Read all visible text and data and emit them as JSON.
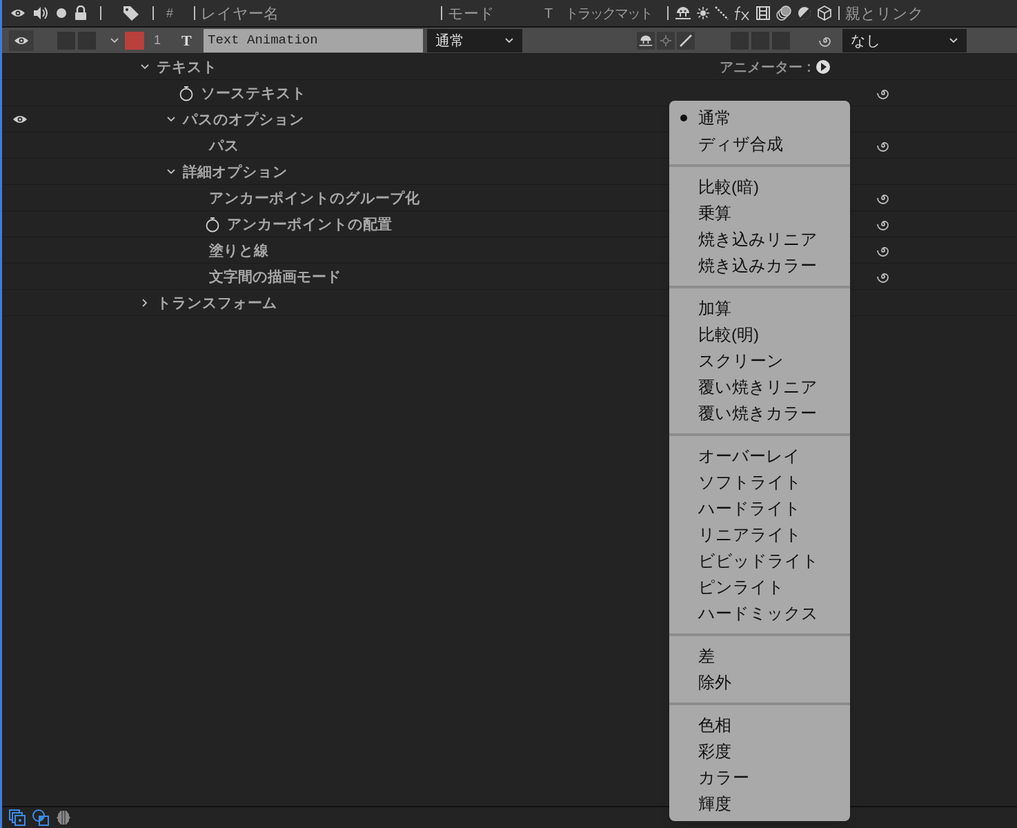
{
  "header": {
    "number": "#",
    "layer_name": "レイヤー名",
    "mode": "モード",
    "track_t": "T",
    "track_matte": "トラックマット",
    "parent": "親とリンク"
  },
  "layer": {
    "visible": true,
    "expanded": true,
    "switches": {
      "shy": true,
      "collapse": false,
      "quality": true
    },
    "number": "1",
    "type_glyph": "T",
    "name": "Text Animation",
    "mode": "通常",
    "parent": "なし"
  },
  "properties": [
    {
      "label": "テキスト",
      "expanded": true,
      "animator": "アニメーター",
      "animator_sep": ":",
      "children": [
        {
          "label": "ソーステキスト",
          "stopwatch": true,
          "pickwhip": true
        },
        {
          "label": "パスのオプション",
          "expanded": true,
          "visible": true,
          "children": [
            {
              "label": "パス",
              "pickwhip": true
            }
          ]
        },
        {
          "label": "詳細オプション",
          "expanded": true,
          "children": [
            {
              "label": "アンカーポイントのグループ化",
              "pickwhip": true
            },
            {
              "label": "アンカーポイントの配置",
              "stopwatch": true,
              "pickwhip": true
            },
            {
              "label": "塗りと線",
              "pickwhip": true
            },
            {
              "label": "文字間の描画モード",
              "pickwhip": true
            }
          ]
        }
      ]
    },
    {
      "label": "トランスフォーム",
      "expanded": false
    }
  ],
  "mode_menu": [
    [
      {
        "label": "通常",
        "selected": true
      },
      {
        "label": "ディザ合成",
        "selected": false
      }
    ],
    [
      {
        "label": "比較(暗)",
        "selected": false
      },
      {
        "label": "乗算",
        "selected": false
      },
      {
        "label": "焼き込みリニア",
        "selected": false
      },
      {
        "label": "焼き込みカラー",
        "selected": false
      }
    ],
    [
      {
        "label": "加算",
        "selected": false
      },
      {
        "label": "比較(明)",
        "selected": false
      },
      {
        "label": "スクリーン",
        "selected": false
      },
      {
        "label": "覆い焼きリニア",
        "selected": false
      },
      {
        "label": "覆い焼きカラー",
        "selected": false
      }
    ],
    [
      {
        "label": "オーバーレイ",
        "selected": false
      },
      {
        "label": "ソフトライト",
        "selected": false
      },
      {
        "label": "ハードライト",
        "selected": false
      },
      {
        "label": "リニアライト",
        "selected": false
      },
      {
        "label": "ビビッドライト",
        "selected": false
      },
      {
        "label": "ピンライト",
        "selected": false
      },
      {
        "label": "ハードミックス",
        "selected": false
      }
    ],
    [
      {
        "label": "差",
        "selected": false
      },
      {
        "label": "除外",
        "selected": false
      }
    ],
    [
      {
        "label": "色相",
        "selected": false
      },
      {
        "label": "彩度",
        "selected": false
      },
      {
        "label": "カラー",
        "selected": false
      },
      {
        "label": "輝度",
        "selected": false
      }
    ]
  ]
}
